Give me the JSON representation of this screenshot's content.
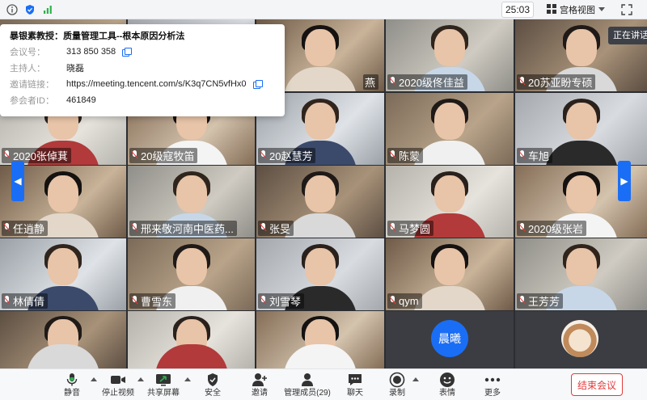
{
  "topbar": {
    "timer": "25:03",
    "layout_label": "宫格视图"
  },
  "meeting_info": {
    "title": "暴银素教授：质量管理工具--根本原因分析法",
    "rows": [
      {
        "label": "会议号：",
        "value": "313 850 358",
        "copy": true
      },
      {
        "label": "主持人：",
        "value": "晓磊",
        "copy": false
      },
      {
        "label": "邀请链接：",
        "value": "https://meeting.tencent.com/s/K3q7CN5vfHx0",
        "copy": true
      },
      {
        "label": "参会者ID：",
        "value": "461849",
        "copy": false
      }
    ]
  },
  "speaking_label": "正在讲话：",
  "participants": [
    {
      "name": "",
      "row": 0,
      "col": 2,
      "name_suffix": "燕"
    },
    {
      "name": "2020级佟佳益",
      "row": 0,
      "col": 3
    },
    {
      "name": "20苏亚盼专硕",
      "row": 0,
      "col": 4
    },
    {
      "name": "2020张倬萁",
      "row": 1,
      "col": 0
    },
    {
      "name": "20级寇牧笛",
      "row": 1,
      "col": 1
    },
    {
      "name": "20赵慧芳",
      "row": 1,
      "col": 2
    },
    {
      "name": "陈蒙",
      "row": 1,
      "col": 3
    },
    {
      "name": "车旭",
      "row": 1,
      "col": 4
    },
    {
      "name": "任逍静",
      "row": 2,
      "col": 0
    },
    {
      "name": "邢来敬河南中医药...",
      "row": 2,
      "col": 1
    },
    {
      "name": "张旻",
      "row": 2,
      "col": 2
    },
    {
      "name": "马梦圆",
      "row": 2,
      "col": 3
    },
    {
      "name": "2020级张岩",
      "row": 2,
      "col": 4
    },
    {
      "name": "林倩倩",
      "row": 3,
      "col": 0
    },
    {
      "name": "曹雪东",
      "row": 3,
      "col": 1
    },
    {
      "name": "刘雪琴",
      "row": 3,
      "col": 2
    },
    {
      "name": "qym",
      "row": 3,
      "col": 3
    },
    {
      "name": "王芳芳",
      "row": 3,
      "col": 4
    }
  ],
  "avatar_tile": {
    "initials": "晨曦"
  },
  "toolbar": {
    "mute": "静音",
    "stop_video": "停止视频",
    "share_screen": "共享屏幕",
    "security": "安全",
    "invite": "邀请",
    "manage_members": "管理成员(29)",
    "chat": "聊天",
    "record": "录制",
    "reactions": "表情",
    "more": "更多",
    "end_meeting": "结束会议"
  },
  "colors": {
    "accent": "#1a6ef5",
    "end": "#e23b3b",
    "grid_bg": "#2b2d31"
  }
}
